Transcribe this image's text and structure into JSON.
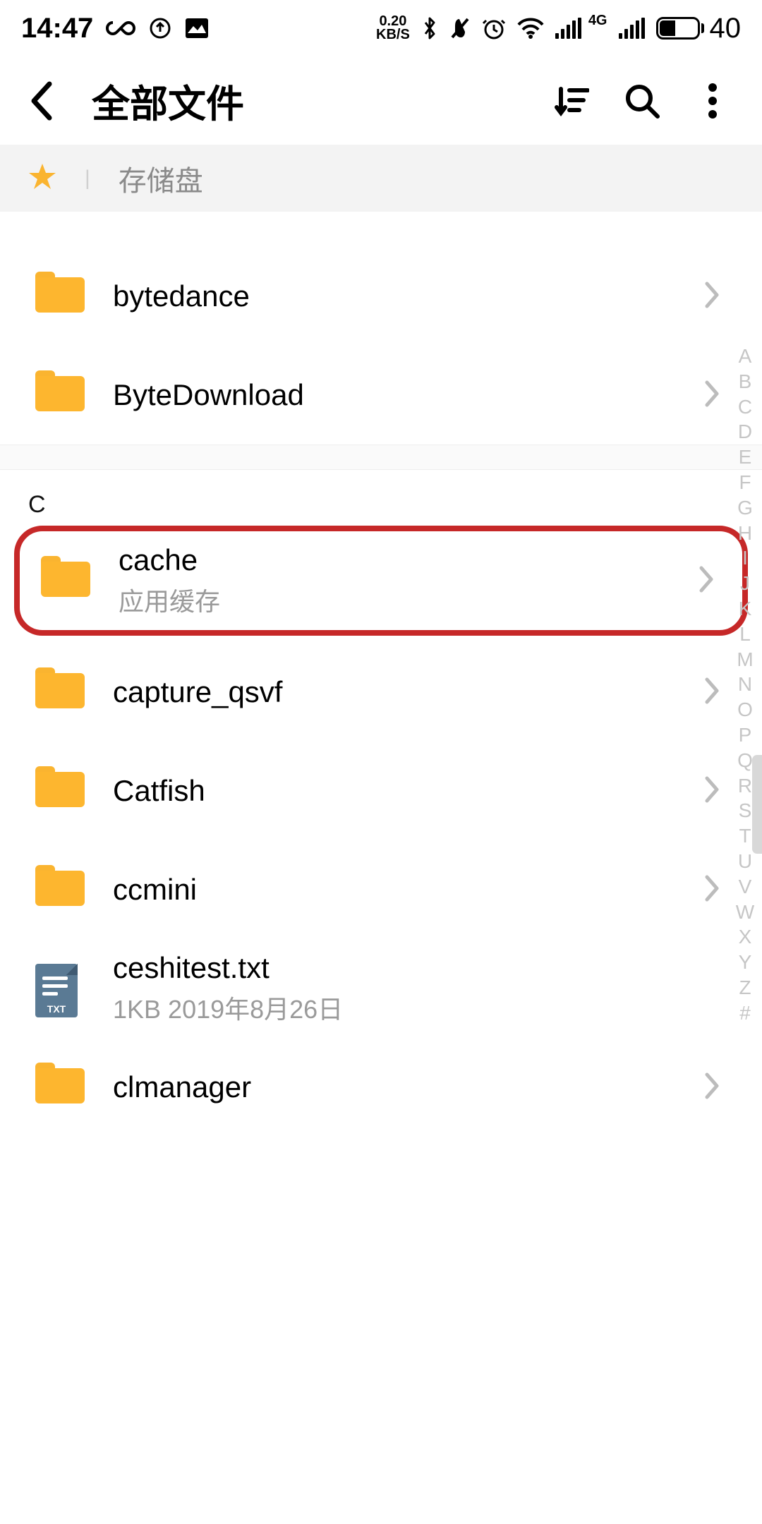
{
  "status_bar": {
    "time": "14:47",
    "net_speed_top": "0.20",
    "net_speed_bottom": "KB/S",
    "battery_pct": "40",
    "sig_label": "4G"
  },
  "toolbar": {
    "title": "全部文件"
  },
  "breadcrumb": {
    "label": "存储盘"
  },
  "section_c": "C",
  "items": [
    {
      "name": "bytedance",
      "sub": "",
      "type": "folder"
    },
    {
      "name": "ByteDownload",
      "sub": "",
      "type": "folder"
    },
    {
      "name": "cache",
      "sub": "应用缓存",
      "type": "folder"
    },
    {
      "name": "capture_qsvf",
      "sub": "",
      "type": "folder"
    },
    {
      "name": "Catfish",
      "sub": "",
      "type": "folder"
    },
    {
      "name": "ccmini",
      "sub": "",
      "type": "folder"
    },
    {
      "name": "ceshitest.txt",
      "sub": "1KB   2019年8月26日",
      "type": "txt"
    },
    {
      "name": "clmanager",
      "sub": "",
      "type": "folder"
    }
  ],
  "alpha_index": [
    "A",
    "B",
    "C",
    "D",
    "E",
    "F",
    "G",
    "H",
    "I",
    "J",
    "K",
    "L",
    "M",
    "N",
    "O",
    "P",
    "Q",
    "R",
    "S",
    "T",
    "U",
    "V",
    "W",
    "X",
    "Y",
    "Z",
    "#"
  ],
  "txt_label": "TXT"
}
